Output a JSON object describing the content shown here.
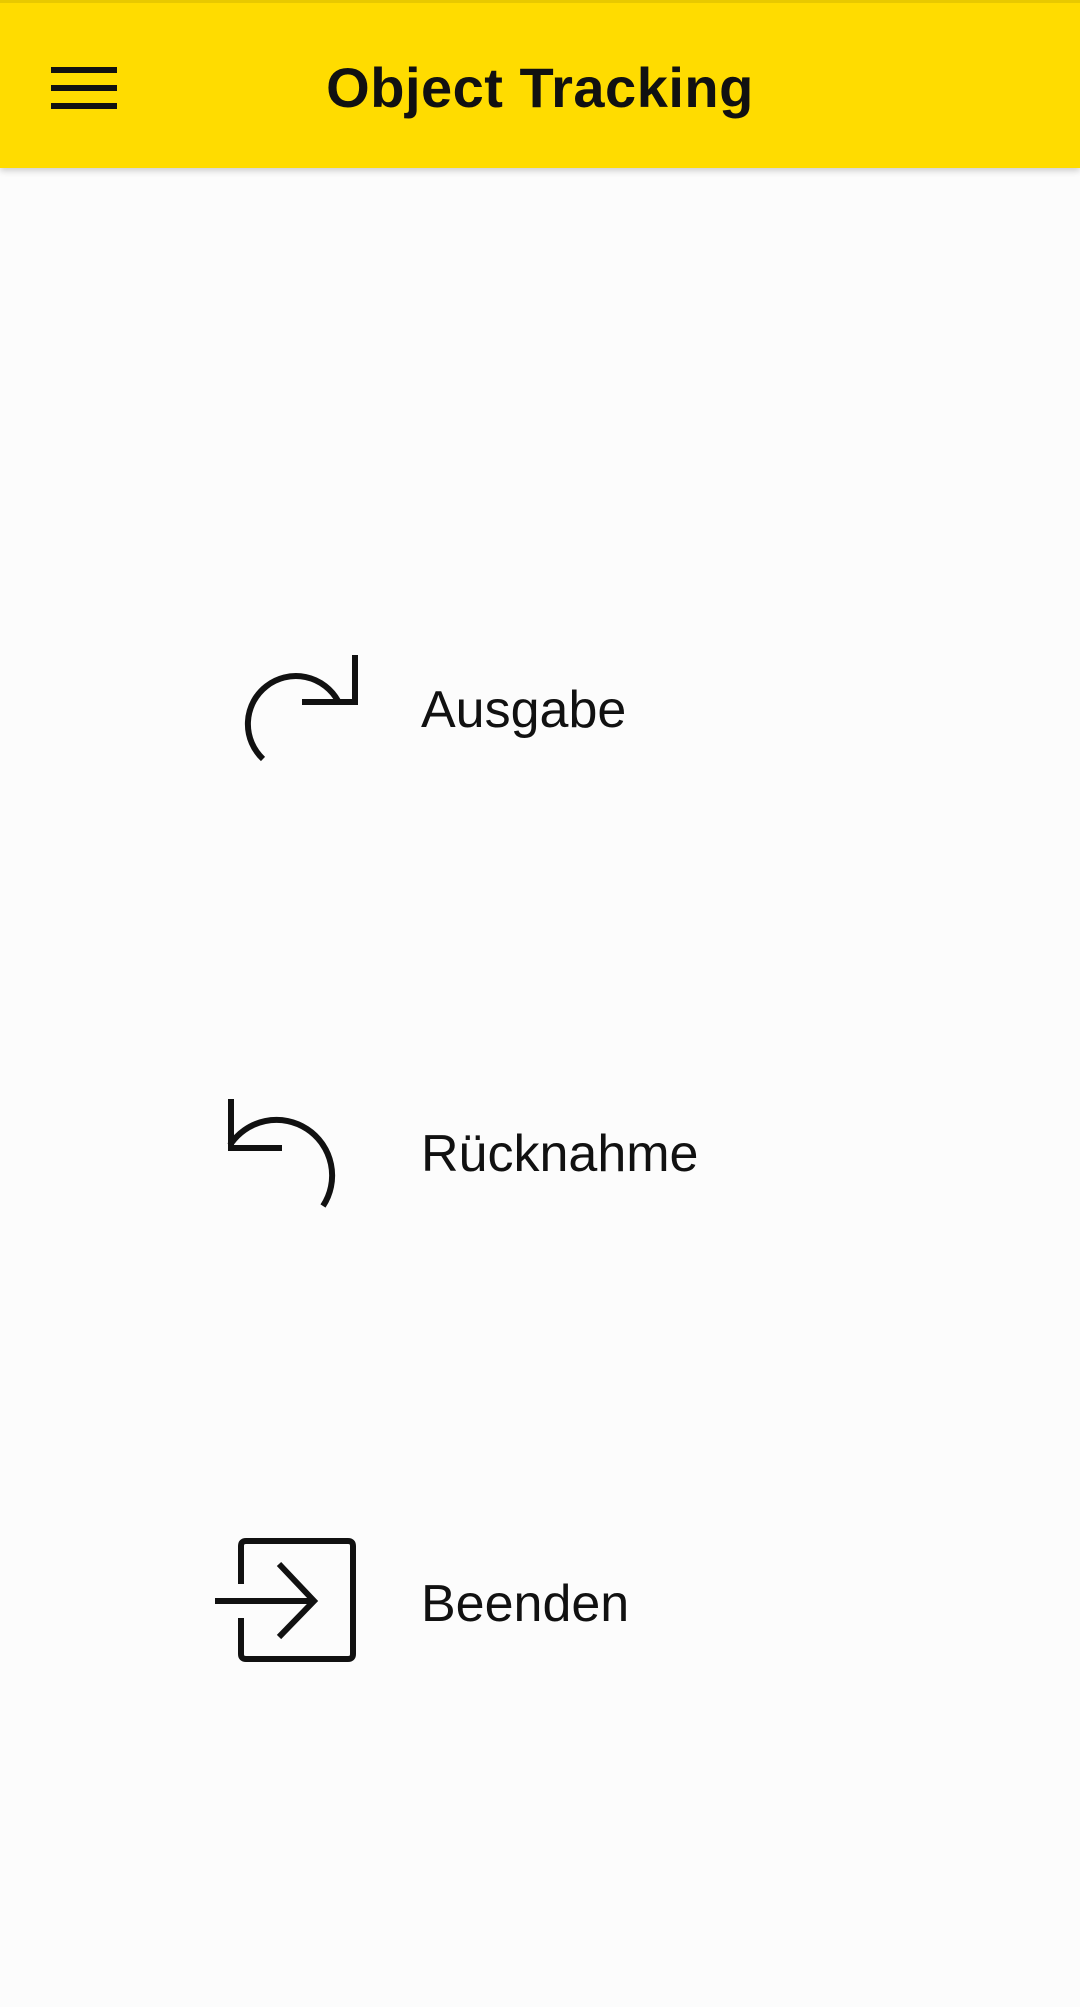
{
  "app_bar": {
    "title": "Object Tracking",
    "menu_icon": "hamburger-menu-icon",
    "background_color": "#ffdc00"
  },
  "actions": [
    {
      "label": "Ausgabe",
      "icon": "redo-arrow-icon"
    },
    {
      "label": "Rücknahme",
      "icon": "undo-arrow-icon"
    },
    {
      "label": "Beenden",
      "icon": "exit-to-app-icon"
    }
  ],
  "colors": {
    "background": "#fcfcfc",
    "text": "#111111",
    "accent": "#ffdc00"
  }
}
